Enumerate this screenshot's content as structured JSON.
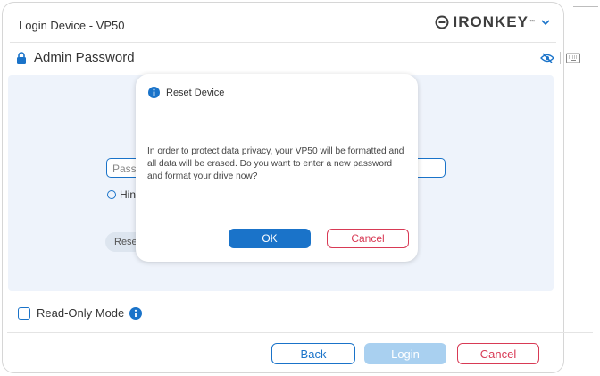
{
  "window": {
    "title": "Login Device - VP50",
    "brand": "IRONKEY",
    "brand_tm": "™"
  },
  "password_section": {
    "title": "Admin Password",
    "field_placeholder": "Pass",
    "hint_label": "Hin",
    "reset_label": "Rese"
  },
  "read_only": {
    "label": "Read-Only Mode",
    "checked": false
  },
  "buttons": {
    "back": "Back",
    "login": "Login",
    "cancel": "Cancel"
  },
  "dialog": {
    "title": "Reset Device",
    "message": "In order to protect data privacy, your VP50 will be formatted and all data will be erased. Do you want to enter a new password and format your drive now?",
    "ok": "OK",
    "cancel": "Cancel"
  },
  "colors": {
    "accent": "#1a73c9",
    "cancel_red": "#d83a55",
    "panel_bg": "#eef3fb",
    "login_disabled": "#a9d0f0"
  },
  "icons": {
    "brand": "ironkey-logo-icon",
    "chevron": "chevron-down-icon",
    "lock": "lock-icon",
    "eye": "eye-slash-icon",
    "keyboard": "keyboard-icon",
    "info": "info-icon"
  }
}
